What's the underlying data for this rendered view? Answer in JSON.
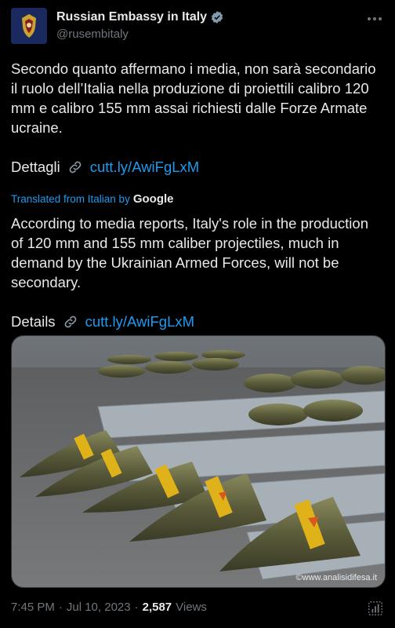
{
  "tweet": {
    "display_name": "Russian Embassy in Italy",
    "handle": "@rusembitaly",
    "original_text": "Secondo quanto affermano i media, non sarà secondario il ruolo dell’Italia nella produzione di proiettili calibro 120 mm e calibro 155 mm assai richiesti dalle Forze Armate ucraine.",
    "original_link_label": "Dettagli",
    "link_text": "cutt.ly/AwiFgLxM",
    "translated_label": "Translated from Italian by",
    "translator": "Google",
    "translated_text": "According to media reports, Italy's role in the production of 120 mm and 155 mm caliber projectiles, much in demand by the Ukrainian Armed Forces, will not be secondary.",
    "translated_link_label": "Details",
    "image_watermark": "©www.analisidifesa.it",
    "time": "7:45 PM",
    "date": "Jul 10, 2023",
    "views_count": "2,587",
    "views_label": "Views",
    "separator": "·"
  },
  "icons": {
    "verified": "verified-badge-icon",
    "more": "more-options-icon",
    "link": "link-chain-icon",
    "stats": "analytics-icon"
  },
  "colors": {
    "accent": "#1d9bf0",
    "background": "#000000",
    "muted": "#71767b"
  }
}
